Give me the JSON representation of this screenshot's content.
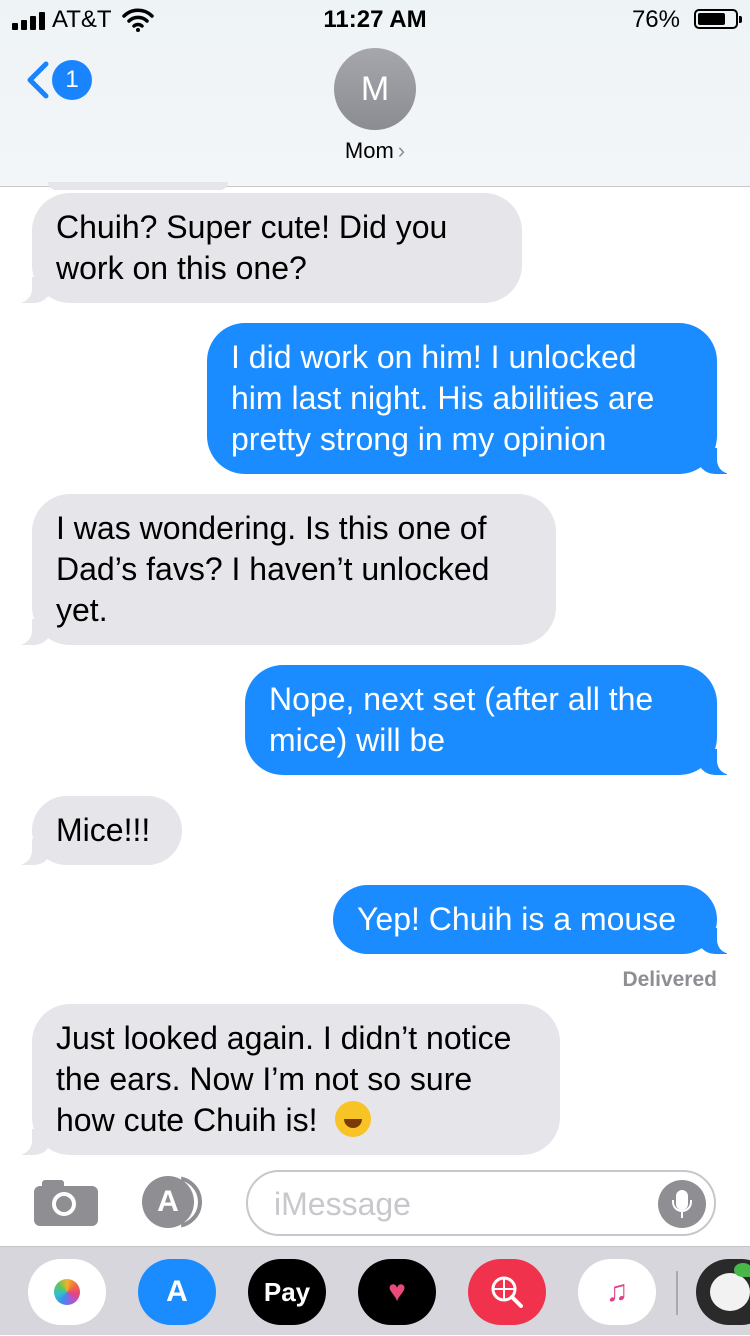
{
  "status_bar": {
    "carrier": "AT&T",
    "time": "11:27 AM",
    "battery_pct": "76%",
    "battery_level": 0.76
  },
  "header": {
    "back_badge": "1",
    "avatar_initial": "M",
    "contact_name": "Mom"
  },
  "messages": [
    {
      "from": "them",
      "text": "Chuih?  Super cute!  Did you work on this one?"
    },
    {
      "from": "me",
      "text": "I did work on him! I unlocked him last night. His abilities are pretty strong in my opinion"
    },
    {
      "from": "them",
      "text": "I was wondering.  Is this one of Dad’s favs?  I haven’t unlocked yet."
    },
    {
      "from": "me",
      "text": "Nope, next set (after all the mice) will be"
    },
    {
      "from": "them",
      "text": "Mice!!!"
    },
    {
      "from": "me",
      "text": "Yep! Chuih is a mouse"
    },
    {
      "from": "them",
      "text": "Just looked again. I didn’t notice the ears. Now I’m not so sure how cute Chuih is!",
      "emoji": "rolling-on-floor-laughing"
    }
  ],
  "delivered_label": "Delivered",
  "input": {
    "placeholder": "iMessage",
    "value": ""
  },
  "app_drawer": {
    "apps": [
      "Photos",
      "App Store",
      "Apple Pay",
      "Digital Touch",
      "Images Search",
      "Music",
      "Game"
    ],
    "applepay_label": "Pay"
  },
  "colors": {
    "sent": "#1a8cff",
    "received": "#e5e5ea",
    "badge": "#1a84ff"
  }
}
